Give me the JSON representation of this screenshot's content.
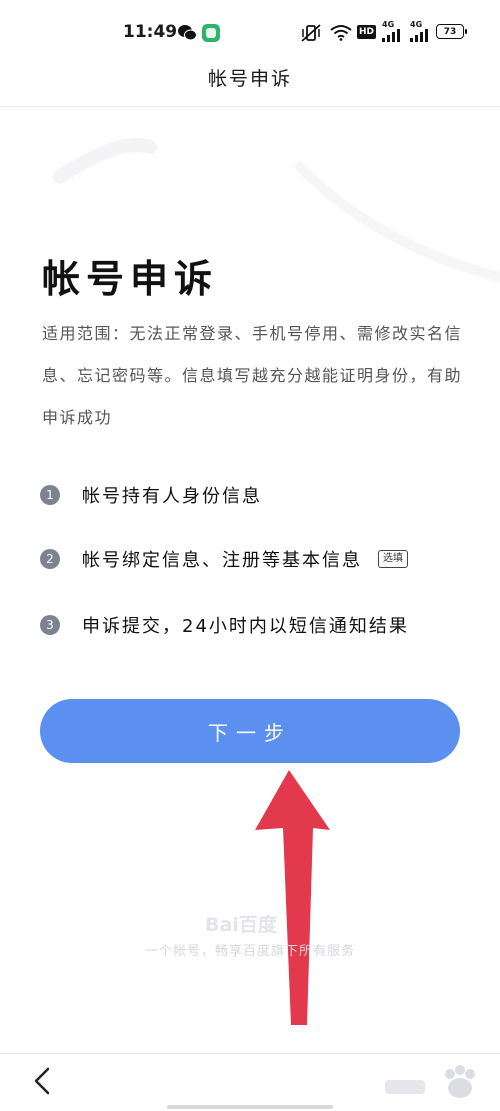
{
  "status_bar": {
    "time": "11:49",
    "battery": "73",
    "network_labels": [
      "HD",
      "4G",
      "4G"
    ],
    "icons": [
      "wechat-icon",
      "app-icon",
      "vibrate-icon",
      "wifi-icon",
      "signal-icon",
      "battery-icon"
    ]
  },
  "header": {
    "title": "帐号申诉"
  },
  "main": {
    "title": "帐号申诉",
    "description": "适用范围：无法正常登录、手机号停用、需修改实名信息、忘记密码等。信息填写越充分越能证明身份，有助申诉成功",
    "steps": [
      {
        "num": "1",
        "label": "帐号持有人身份信息"
      },
      {
        "num": "2",
        "label": "帐号绑定信息、注册等基本信息",
        "tag": "选填"
      },
      {
        "num": "3",
        "label": "申诉提交，24小时内以短信通知结果"
      }
    ],
    "next_button": "下一步"
  },
  "footer": {
    "logo_text": "Bai百度",
    "note": "一个帐号，畅享百度旗下所有服务"
  },
  "colors": {
    "primary": "#5b8ff0",
    "arrow": "#e23a4c",
    "step_badge": "#7d8291"
  }
}
